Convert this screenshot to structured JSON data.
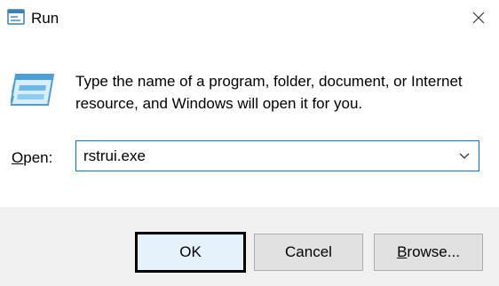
{
  "window": {
    "title": "Run",
    "title_icon": "run-dialog-icon",
    "close_icon": "close-icon"
  },
  "dialog": {
    "icon": "run-program-icon",
    "description": "Type the name of a program, folder, document, or Internet resource, and Windows will open it for you.",
    "open_label_accel": "O",
    "open_label_rest": "pen:",
    "open_value": "rstrui.exe",
    "dropdown_icon": "chevron-down-icon"
  },
  "buttons": {
    "ok": "OK",
    "cancel": "Cancel",
    "browse_accel": "B",
    "browse_rest": "rowse..."
  },
  "colors": {
    "accent": "#0078d7",
    "footer_bg": "#f0f0f0",
    "button_bg": "#e1e1e1",
    "default_button_bg": "#e5f1fb"
  }
}
